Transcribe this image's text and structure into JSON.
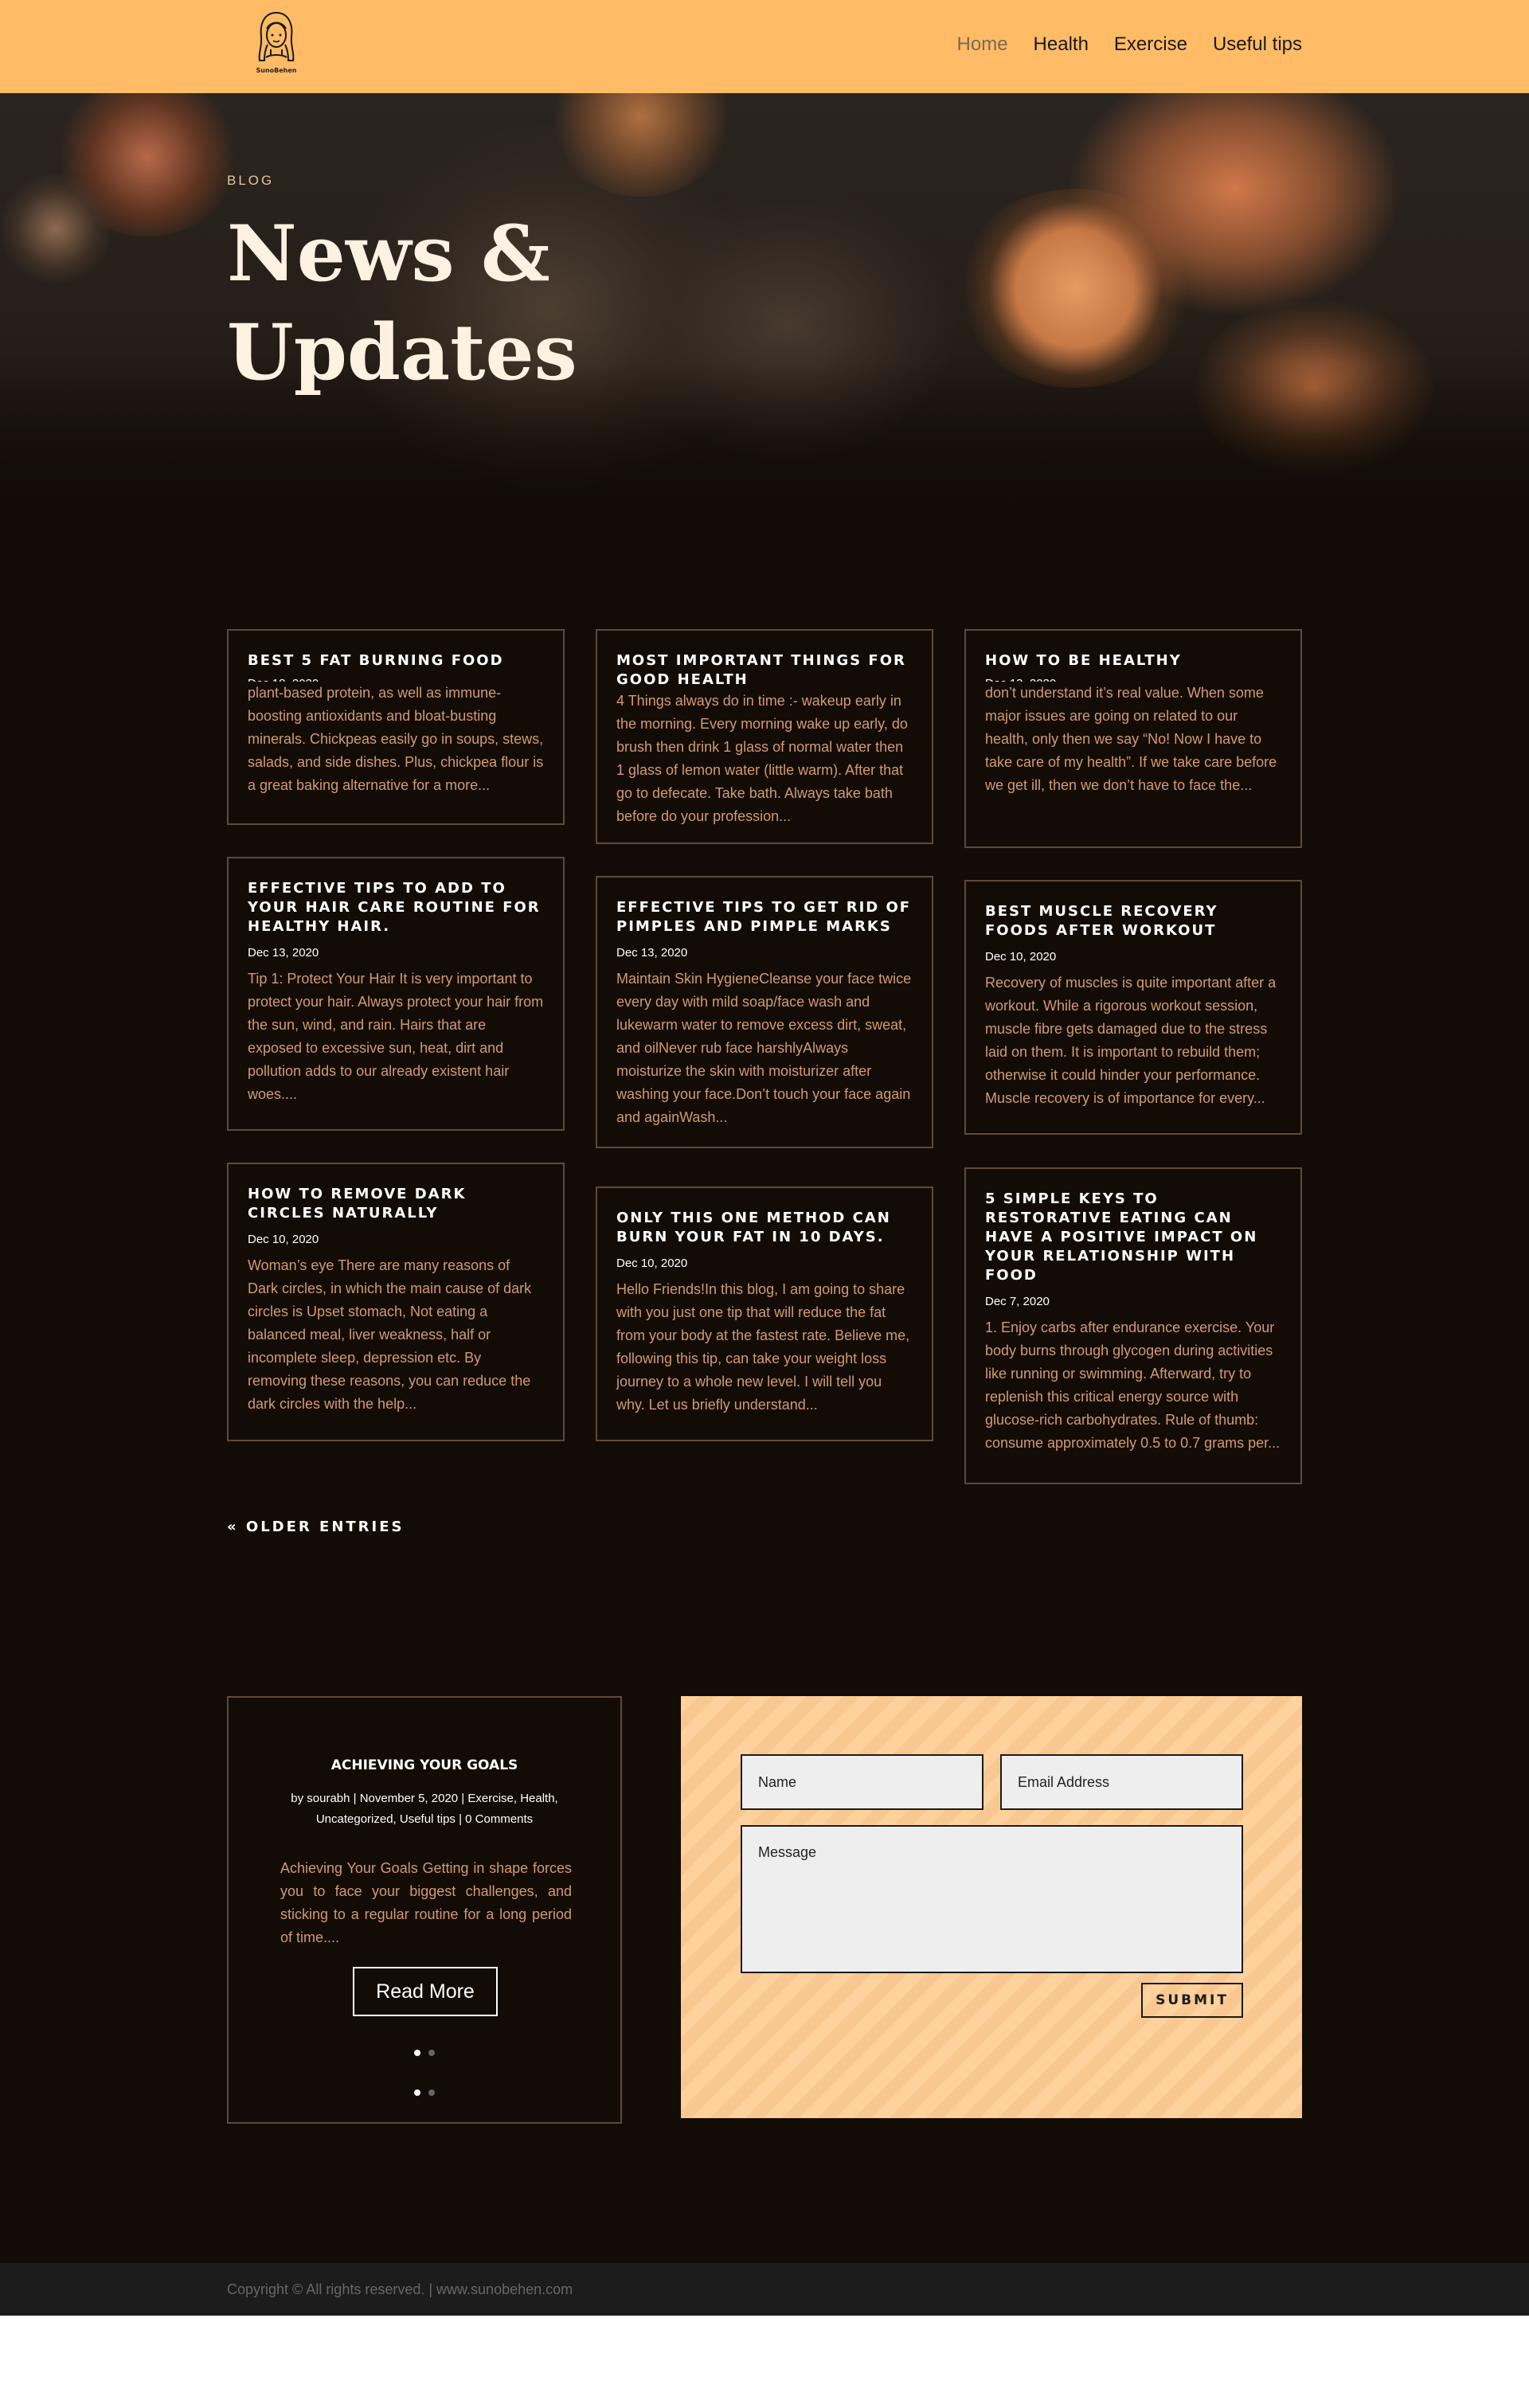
{
  "header": {
    "logo_text": "SunoBehen",
    "nav": [
      {
        "label": "Home"
      },
      {
        "label": "Health"
      },
      {
        "label": "Exercise"
      },
      {
        "label": "Useful tips"
      }
    ]
  },
  "hero": {
    "label": "BLOG",
    "title_line1": "News &",
    "title_line2": "Updates"
  },
  "posts": [
    {
      "title": "BEST 5 FAT BURNING FOOD",
      "date": "Dec 18, 2020",
      "excerpt": "plant-based protein, as well as immune-boosting antioxidants and bloat-busting minerals. Chickpeas easily go in soups, stews, salads, and side dishes. Plus, chickpea flour is a great baking alternative for a more..."
    },
    {
      "title": "MOST IMPORTANT THINGS FOR GOOD HEALTH",
      "date": "",
      "excerpt": "4 Things always do in time :- wakeup early in the morning. Every morning wake up early, do brush then drink 1 glass of normal water then 1 glass of lemon water (little warm). After that go to defecate. Take bath. Always take bath before do your profession..."
    },
    {
      "title": "HOW TO BE HEALTHY",
      "date": "Dec 13, 2020",
      "excerpt": "don’t understand it’s real value. When some major issues are going on related to our health, only then we say “No! Now I have to take care of my health”. If we take care before we get ill, then we don’t have to face the..."
    },
    {
      "title": "EFFECTIVE TIPS TO ADD TO YOUR HAIR CARE ROUTINE FOR HEALTHY HAIR.",
      "date": "Dec 13, 2020",
      "excerpt": "Tip 1: Protect Your Hair It is very important to protect your hair. Always protect your hair from the sun, wind, and rain. Hairs that are exposed to excessive sun, heat, dirt and pollution adds to our already existent hair woes...."
    },
    {
      "title": "EFFECTIVE TIPS TO GET RID OF PIMPLES AND PIMPLE MARKS",
      "date": "Dec 13, 2020",
      "excerpt": "Maintain Skin HygieneCleanse your face twice every day with mild soap/face wash and lukewarm water to remove excess dirt, sweat, and oilNever rub face harshlyAlways moisturize the skin with moisturizer after washing your face.Don’t touch your face again and againWash..."
    },
    {
      "title": "BEST MUSCLE RECOVERY FOODS AFTER WORKOUT",
      "date": "Dec 10, 2020",
      "excerpt": "Recovery of muscles is quite important after a workout. While a rigorous workout session, muscle fibre gets damaged due to the stress laid on them. It is important to rebuild them; otherwise it could hinder your performance. Muscle recovery is of importance for every..."
    },
    {
      "title": "HOW TO REMOVE DARK CIRCLES NATURALLY",
      "date": "Dec 10, 2020",
      "excerpt": "Woman’s eye There are many reasons of Dark circles, in which the main cause of dark circles is Upset stomach, Not eating a balanced meal, liver weakness, half or incomplete sleep, depression etc. By removing these reasons, you can reduce the dark circles with the help..."
    },
    {
      "title": "ONLY THIS ONE METHOD CAN BURN YOUR FAT IN 10 DAYS.",
      "date": "Dec 10, 2020",
      "excerpt": "Hello Friends!In this blog, I am going to share with you just one tip that will reduce the fat from your body at the fastest rate. Believe me, following this tip, can take your weight loss journey to a whole new level. I will tell you why. Let us briefly understand..."
    },
    {
      "title": "5 SIMPLE KEYS TO RESTORATIVE EATING CAN HAVE A POSITIVE IMPACT ON YOUR RELATIONSHIP WITH FOOD",
      "date": "Dec 7, 2020",
      "excerpt": "1. Enjoy carbs after endurance exercise. Your body burns through glycogen during activities like running or swimming. Afterward, try to replenish this critical energy source with glucose-rich carbohydrates. Rule of thumb: consume approximately 0.5 to 0.7 grams per..."
    }
  ],
  "pagination": {
    "older": "« OLDER ENTRIES"
  },
  "featured": {
    "title": "ACHIEVING YOUR GOALS",
    "meta": "by sourabh | November 5, 2020 | Exercise, Health, Uncategorized, Useful tips | 0 Comments",
    "excerpt": "Achieving Your Goals    Getting in shape forces you to face your biggest challenges, and sticking to a regular routine for a long period of time....",
    "button": "Read More"
  },
  "contact_form": {
    "name_placeholder": "Name",
    "email_placeholder": "Email Address",
    "message_placeholder": "Message",
    "submit": "SUBMIT"
  },
  "footer": {
    "copyright": "Copyright © All rights reserved. | www.sunobehen.com"
  },
  "colors": {
    "header_bg": "#ffbb66",
    "page_bg": "#130c06",
    "card_border": "#5e4a3a",
    "excerpt_text": "#d19a72",
    "form_bg": "#ffcd94",
    "footer_bg": "#1c1c1c"
  }
}
